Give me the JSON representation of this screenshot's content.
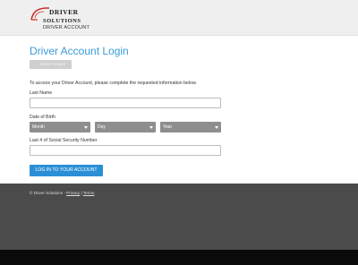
{
  "header": {
    "logo": {
      "line1": "DRIVER",
      "line2": "SOLUTIONS",
      "line3": "DRIVER ACCOUNT"
    }
  },
  "main": {
    "title": "Driver Account Login",
    "disabled_button": "← Driver Account",
    "intro": "To access your Driver Account, please complete the requested information below.",
    "last_name": {
      "label": "Last Name",
      "value": "",
      "placeholder": ""
    },
    "dob": {
      "label": "Date of Birth",
      "month": "Month",
      "day": "Day",
      "year": "Year"
    },
    "ssn": {
      "label": "Last 4 of Social Security Number",
      "value": "",
      "placeholder": ""
    },
    "submit_label": "LOG IN TO YOUR ACCOUNT"
  },
  "footer": {
    "copyright": "© Driver Solutions -",
    "privacy": "Privacy",
    "separator": "|",
    "terms": "Terms"
  },
  "colors": {
    "accent": "#3a9ad9",
    "button": "#2b8fd6",
    "logo_red": "#c9302c",
    "footer": "#4b4b4b"
  }
}
